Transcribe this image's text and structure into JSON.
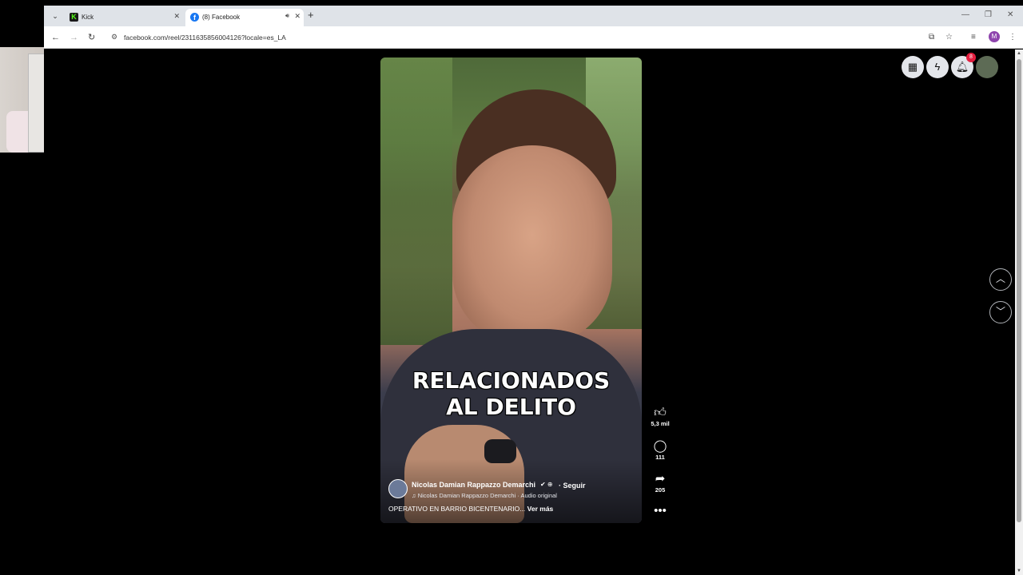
{
  "browser": {
    "tabs": [
      {
        "title": "Kick",
        "favicon": "kick-logo-icon",
        "active": false
      },
      {
        "title": "(8) Facebook",
        "favicon": "facebook-logo-icon",
        "active": true
      }
    ],
    "url": "facebook.com/reel/2311635856004126?locale=es_LA",
    "profile_initial": "M"
  },
  "facebook": {
    "notification_count": "8",
    "reel": {
      "caption_line1": "RELACIONADOS",
      "caption_line2": "AL DELITO",
      "author": "Nicolas Damian Rappazzo Demarchi",
      "follow_label": "· Seguir",
      "audio": "♫ Nicolas Damian Rappazzo Demarchi · Audio original",
      "description": "OPERATIVO EN BARRIO BICENTENARIO...",
      "see_more": "Ver más"
    },
    "actions": {
      "likes": "5,3 mil",
      "comments": "111",
      "shares": "205"
    }
  },
  "colors": {
    "facebook_blue": "#1877f2",
    "kick_green": "#53fc18",
    "badge_red": "#e41e3f"
  }
}
